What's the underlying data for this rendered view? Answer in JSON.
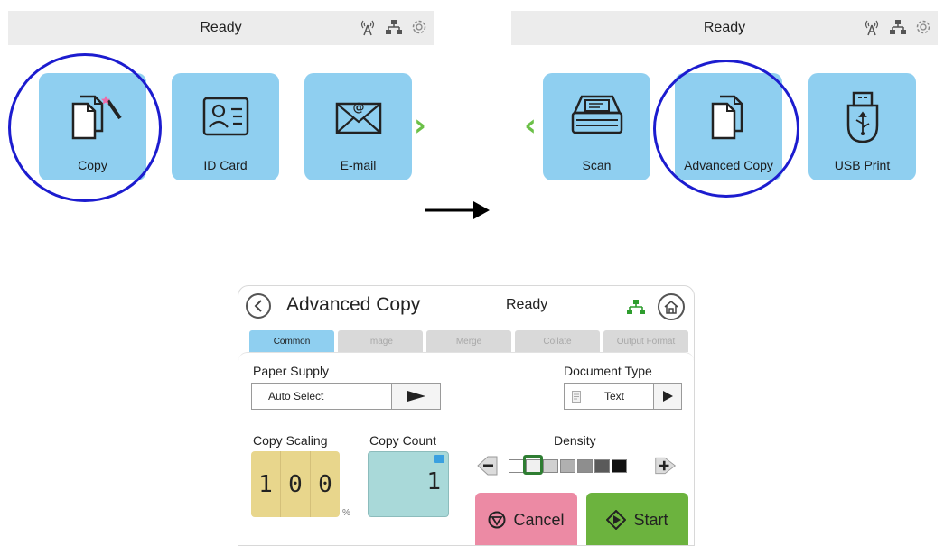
{
  "left_panel": {
    "status": "Ready",
    "tiles": [
      {
        "label": "Copy",
        "icon": "copy-icon"
      },
      {
        "label": "ID Card",
        "icon": "id-card-icon"
      },
      {
        "label": "E-mail",
        "icon": "email-icon"
      }
    ],
    "next_icon": "chevron-right-icon"
  },
  "right_panel": {
    "status": "Ready",
    "tiles": [
      {
        "label": "Scan",
        "icon": "scanner-icon"
      },
      {
        "label": "Advanced Copy",
        "icon": "advanced-copy-icon"
      },
      {
        "label": "USB Print",
        "icon": "usb-icon"
      }
    ],
    "prev_icon": "chevron-left-icon"
  },
  "advanced_copy": {
    "title": "Advanced Copy",
    "status": "Ready",
    "tabs": [
      "Common",
      "Image",
      "Merge",
      "Collate",
      "Output Format"
    ],
    "active_tab": "Common",
    "paper_supply": {
      "label": "Paper Supply",
      "value": "Auto Select"
    },
    "document_type": {
      "label": "Document Type",
      "value": "Text"
    },
    "copy_scaling": {
      "label": "Copy Scaling",
      "digits": [
        "1",
        "0",
        "0"
      ],
      "unit": "%"
    },
    "copy_count": {
      "label": "Copy Count",
      "value": "1"
    },
    "density": {
      "label": "Density",
      "level": 2,
      "levels": 7
    },
    "cancel_label": "Cancel",
    "start_label": "Start"
  },
  "colors": {
    "tile": "#8fcff0",
    "highlight_ring": "#1c1ccf",
    "chevron": "#6bc048",
    "cancel": "#ec8aa4",
    "start": "#6cb33e",
    "scale_box": "#e8d68c",
    "count_box": "#a9d9d9"
  }
}
